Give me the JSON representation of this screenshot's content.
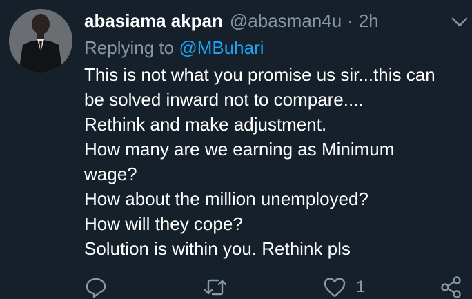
{
  "tweet": {
    "display_name": "abasiama akpan",
    "handle": "@abasman4u",
    "separator": "·",
    "time": "2h",
    "reply_prefix": "Replying to",
    "reply_to": "@MBuhari",
    "body_lines": [
      "This is not what you promise us sir...this can",
      "be solved inward not to compare....",
      "Rethink and make adjustment.",
      "How many are we earning as Minimum",
      "wage?",
      "How about the million unemployed?",
      "How will they cope?",
      "Solution is within you. Rethink pls"
    ]
  },
  "actions": {
    "reply_icon": "reply-icon",
    "retweet_icon": "retweet-icon",
    "like_icon": "heart-icon",
    "like_count": "1",
    "share_icon": "share-icon"
  },
  "menu": {
    "caret_icon": "chevron-down-icon"
  },
  "colors": {
    "background": "#15202b",
    "primary_text": "#ffffff",
    "secondary_text": "#8899a6",
    "link": "#1da1f2"
  }
}
